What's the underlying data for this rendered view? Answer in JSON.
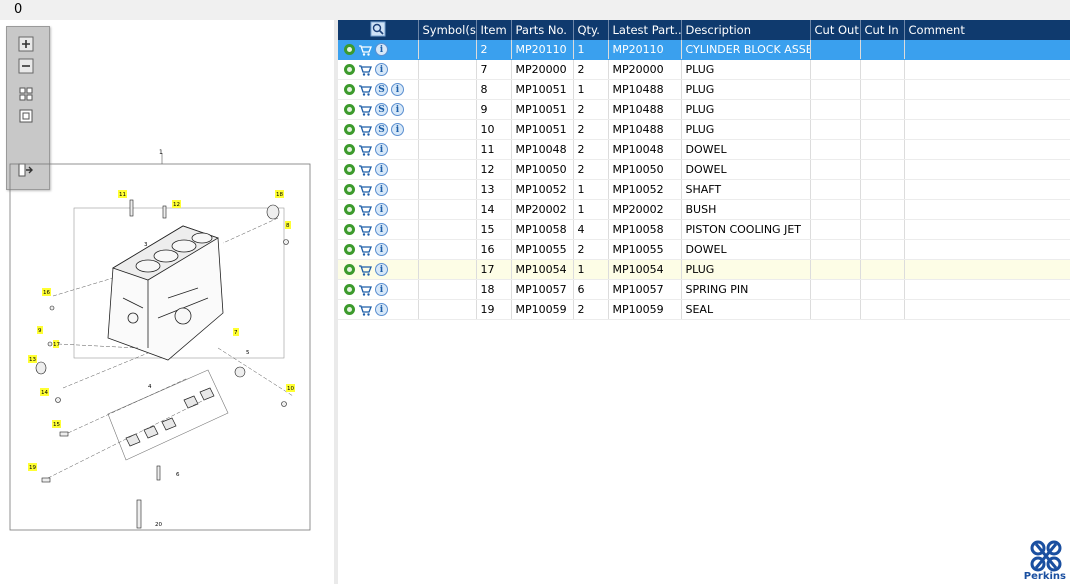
{
  "topbar": {
    "counter": "0"
  },
  "toolbox": {
    "tools": [
      "zoom-in-icon",
      "zoom-out-icon",
      "fit-all-icon",
      "fit-window-icon",
      "export-icon"
    ]
  },
  "diagram": {
    "callouts": [
      "1",
      "2",
      "3",
      "4",
      "5",
      "6",
      "7",
      "8",
      "9",
      "10",
      "11",
      "12",
      "13",
      "14",
      "15",
      "16",
      "17",
      "18",
      "19",
      "20"
    ],
    "highlight_color": "#ffff33"
  },
  "table": {
    "headers": {
      "search": "",
      "symbols": "Symbol(s)",
      "item": "Item",
      "parts_no": "Parts No.",
      "qty": "Qty.",
      "latest_part": "Latest Part...",
      "description": "Description",
      "cut_out": "Cut Out",
      "cut_in": "Cut In",
      "comment": "Comment"
    },
    "rows": [
      {
        "item": "2",
        "parts_no": "MP20110",
        "qty": "1",
        "latest": "MP20110",
        "desc": "CYLINDER BLOCK ASSEMBLY",
        "s": false,
        "selected": true
      },
      {
        "item": "7",
        "parts_no": "MP20000",
        "qty": "2",
        "latest": "MP20000",
        "desc": "PLUG",
        "s": false
      },
      {
        "item": "8",
        "parts_no": "MP10051",
        "qty": "1",
        "latest": "MP10488",
        "desc": "PLUG",
        "s": true
      },
      {
        "item": "9",
        "parts_no": "MP10051",
        "qty": "2",
        "latest": "MP10488",
        "desc": "PLUG",
        "s": true
      },
      {
        "item": "10",
        "parts_no": "MP10051",
        "qty": "2",
        "latest": "MP10488",
        "desc": "PLUG",
        "s": true
      },
      {
        "item": "11",
        "parts_no": "MP10048",
        "qty": "2",
        "latest": "MP10048",
        "desc": "DOWEL",
        "s": false
      },
      {
        "item": "12",
        "parts_no": "MP10050",
        "qty": "2",
        "latest": "MP10050",
        "desc": "DOWEL",
        "s": false
      },
      {
        "item": "13",
        "parts_no": "MP10052",
        "qty": "1",
        "latest": "MP10052",
        "desc": "SHAFT",
        "s": false
      },
      {
        "item": "14",
        "parts_no": "MP20002",
        "qty": "1",
        "latest": "MP20002",
        "desc": "BUSH",
        "s": false
      },
      {
        "item": "15",
        "parts_no": "MP10058",
        "qty": "4",
        "latest": "MP10058",
        "desc": "PISTON COOLING JET",
        "s": false
      },
      {
        "item": "16",
        "parts_no": "MP10055",
        "qty": "2",
        "latest": "MP10055",
        "desc": "DOWEL",
        "s": false
      },
      {
        "item": "17",
        "parts_no": "MP10054",
        "qty": "1",
        "latest": "MP10054",
        "desc": "PLUG",
        "s": false,
        "hover": true
      },
      {
        "item": "18",
        "parts_no": "MP10057",
        "qty": "6",
        "latest": "MP10057",
        "desc": "SPRING PIN",
        "s": false
      },
      {
        "item": "19",
        "parts_no": "MP10059",
        "qty": "2",
        "latest": "MP10059",
        "desc": "SEAL",
        "s": false
      }
    ]
  },
  "brand": {
    "name": "Perkins",
    "color": "#1a4fa0"
  },
  "colors": {
    "header_bg": "#0f3a6e",
    "selected_row": "#3aa0ee",
    "hover_row": "#fdfde6"
  }
}
